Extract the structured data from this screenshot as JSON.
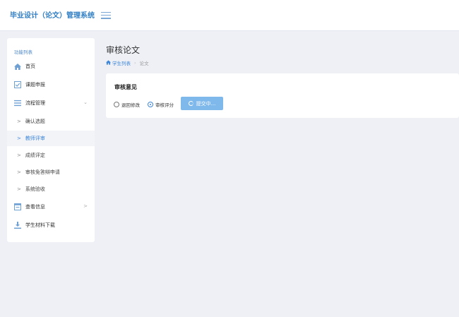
{
  "header": {
    "title": "毕业设计（论文）管理系统",
    "menu_icon": "hamburger-icon"
  },
  "sidebar": {
    "heading": "功能列表",
    "items": [
      {
        "label": "首页",
        "icon": "home-icon"
      },
      {
        "label": "课题申报",
        "icon": "checkbox-icon"
      },
      {
        "label": "流程管理",
        "icon": "list-icon",
        "expanded": true
      },
      {
        "label": "查看信息",
        "icon": "calendar-icon",
        "expanded": false
      },
      {
        "label": "学生材料下载",
        "icon": "download-icon"
      }
    ],
    "sub_items": [
      {
        "label": "确认选题",
        "active": false
      },
      {
        "label": "教师评审",
        "active": true
      },
      {
        "label": "成绩评定",
        "active": false
      },
      {
        "label": "审核免答辩申请",
        "active": false
      },
      {
        "label": "系统验收",
        "active": false
      }
    ]
  },
  "main": {
    "page_title": "审核论文",
    "breadcrumb": [
      "学生列表",
      "论文"
    ],
    "card": {
      "title": "审核意见",
      "options": [
        {
          "label": "退回修改",
          "checked": false
        },
        {
          "label": "审核评分",
          "checked": true
        }
      ],
      "submit_label": "提交中..."
    }
  },
  "colors": {
    "accent": "#3d86d8",
    "brand": "#2f7ec4",
    "background": "#eef0f6",
    "button": "#7fb8ea"
  }
}
